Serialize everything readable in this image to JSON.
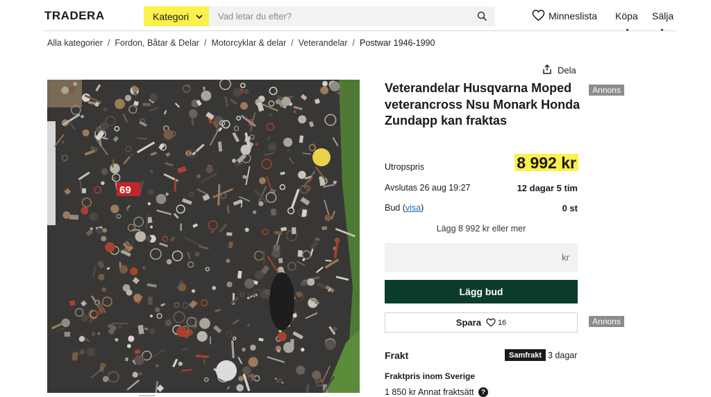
{
  "header": {
    "logo": "TRADERA",
    "category_label": "Kategori",
    "search_placeholder": "Vad letar du efter?",
    "wishlist_label": "Minneslista",
    "buy_label": "Köpa",
    "sell_label": "Sälja"
  },
  "breadcrumb": [
    "Alla kategorier",
    "Fordon, Båtar & Delar",
    "Motorcyklar & delar",
    "Veterandelar",
    "Postwar 1946-1990"
  ],
  "breadcrumb_separator": "/",
  "listing": {
    "share_label": "Dela",
    "title": "Veterandelar Husqvarna Moped veterancross Nsu Monark Honda Zundapp kan fraktas",
    "ad_badge": "Annons",
    "start_price_label": "Utropspris",
    "price": "8 992 kr",
    "ends_label": "Avslutas 26 aug 19:27",
    "time_left": "12 dagar 5 tim",
    "bids_label_prefix": "Bud (",
    "bids_link": "visa",
    "bids_label_suffix": ")",
    "bids_count": "0 st",
    "bid_hint": "Lägg 8 992 kr eller mer",
    "bid_unit": "kr",
    "bid_button": "Lägg bud",
    "save_button": "Spara",
    "save_count": "16",
    "ad_badge_2": "Annons"
  },
  "shipping": {
    "title": "Frakt",
    "badge": "Samfrakt",
    "days": "3 dagar",
    "subtitle": "Fraktpris inom Sverige",
    "price_line": "1 850 kr Annat fraktsätt",
    "help": "?"
  },
  "colors": {
    "brand_yellow": "#fdf04d",
    "bid_button": "#0c3d2a",
    "ad_badge": "#8c8c8c",
    "link": "#1a6fb5"
  },
  "icons": {
    "category_chevron": "chevron-down-icon",
    "search": "search-icon",
    "wishlist": "heart-icon",
    "share": "share-icon",
    "save": "heart-icon",
    "help": "question-icon"
  },
  "photo": {
    "badge_text": "69"
  }
}
